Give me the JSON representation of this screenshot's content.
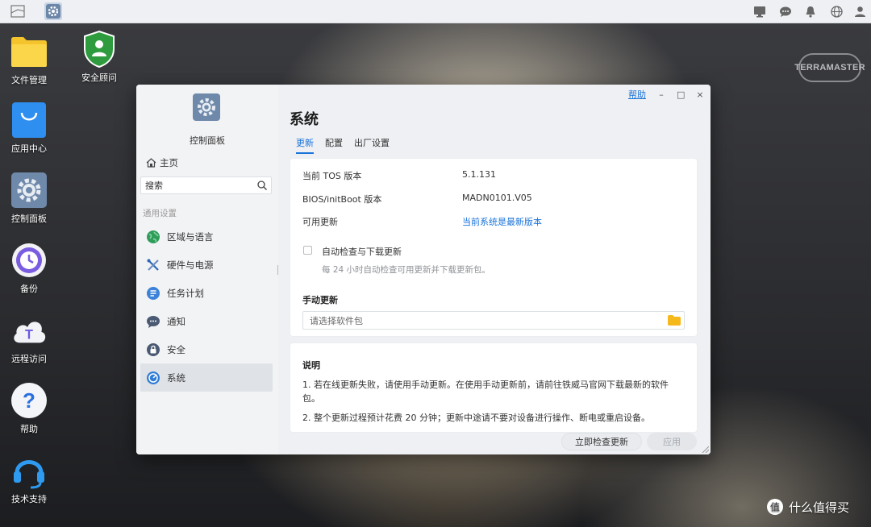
{
  "taskbar": {
    "left_icons": [
      "desktop-icon",
      "control-panel-icon"
    ],
    "right_icons": [
      "monitor-icon",
      "chat-icon",
      "bell-icon",
      "globe-icon",
      "user-icon"
    ]
  },
  "desktop": {
    "icons": [
      {
        "label": "文件管理",
        "icon": "folder-icon"
      },
      {
        "label": "安全顾问",
        "icon": "shield-icon"
      },
      {
        "label": "应用中心",
        "icon": "shopping-bag-icon"
      },
      {
        "label": "控制面板",
        "icon": "gear-icon"
      },
      {
        "label": "备份",
        "icon": "clock-icon"
      },
      {
        "label": "远程访问",
        "icon": "cloud-icon"
      },
      {
        "label": "帮助",
        "icon": "question-icon"
      },
      {
        "label": "技术支持",
        "icon": "headset-icon"
      }
    ],
    "brand": "TERRAMASTER",
    "watermark": "什么值得买",
    "watermark_badge": "值"
  },
  "window": {
    "help_label": "帮助",
    "minimize": "–",
    "maximize": "□",
    "close": "×",
    "sidebar": {
      "app_title": "控制面板",
      "home_label": "主页",
      "search_placeholder": "搜索",
      "section_label": "通用设置",
      "items": [
        {
          "label": "区域与语言",
          "icon": "globe-icon"
        },
        {
          "label": "硬件与电源",
          "icon": "tools-icon"
        },
        {
          "label": "任务计划",
          "icon": "list-icon"
        },
        {
          "label": "通知",
          "icon": "chat-bubble-icon"
        },
        {
          "label": "安全",
          "icon": "lock-icon"
        },
        {
          "label": "系统",
          "icon": "system-icon",
          "active": true
        }
      ]
    },
    "main": {
      "title": "系统",
      "tabs": [
        "更新",
        "配置",
        "出厂设置"
      ],
      "active_tab": "更新",
      "info": {
        "tos_label": "当前 TOS 版本",
        "tos_value": "5.1.131",
        "bios_label": "BIOS/initBoot 版本",
        "bios_value": "MADN0101.V05",
        "update_label": "可用更新",
        "update_value": "当前系统是最新版本"
      },
      "auto_check_label": "自动检查与下载更新",
      "auto_check_hint": "每 24 小时自动检查可用更新并下载更新包。",
      "auto_check_checked": false,
      "manual_title": "手动更新",
      "file_placeholder": "请选择软件包",
      "notes_title": "说明",
      "notes": [
        "1. 若在线更新失败，请使用手动更新。在使用手动更新前，请前往铁威马官网下载最新的软件包。",
        "2. 整个更新过程预计花费 20 分钟；更新中途请不要对设备进行操作、断电或重启设备。"
      ],
      "check_button": "立即检查更新",
      "apply_button": "应用"
    }
  },
  "colors": {
    "accent": "#1a73d9",
    "folder": "#f5c32c",
    "shield": "#2e9c3e"
  }
}
